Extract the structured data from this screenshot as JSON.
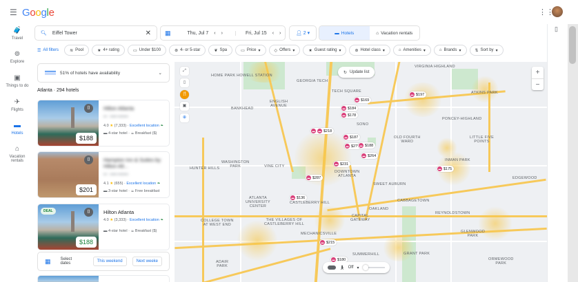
{
  "header": {
    "brand": "Google",
    "menu_icon": "menu-icon",
    "apps_icon": "apps-grid-icon"
  },
  "rail": [
    {
      "label": "Travel",
      "icon": "suitcase-icon"
    },
    {
      "label": "Explore",
      "icon": "explore-icon"
    },
    {
      "label": "Things to do",
      "icon": "camera-icon"
    },
    {
      "label": "Flights",
      "icon": "airplane-icon"
    },
    {
      "label": "Hotels",
      "icon": "bed-icon",
      "active": true
    },
    {
      "label": "Vacation rentals",
      "icon": "house-icon"
    }
  ],
  "search": {
    "value": "Eiffel Tower"
  },
  "dates": {
    "checkin": "Thu, Jul 7",
    "checkout": "Fri, Jul 15"
  },
  "guests": {
    "count": "2"
  },
  "tabs": {
    "hotels": "Hotels",
    "vacation": "Vacation rentals"
  },
  "filters": [
    "All filters",
    "Pool",
    "4+ rating",
    "Under $100",
    "4- or 5-star",
    "Spa",
    "Price",
    "Offers",
    "Guest rating",
    "Hotel class",
    "Amenities",
    "Brands",
    "Sort by"
  ],
  "availability": "51% of hotels have availability",
  "results_count": "Atlanta · 294 hotels",
  "hotels": [
    {
      "name": "Hilton Atlanta",
      "price": "$188",
      "rating": "4.0",
      "reviews": "(7,333)",
      "highlight": "Excellent location",
      "class": "4-star hotel",
      "amenity": "Breakfast ($)",
      "deal": false
    },
    {
      "name": "Hampton Inn & Suites by Hilton Atl...",
      "price": "$201",
      "rating": "4.1",
      "reviews": "(655)",
      "highlight": "Excellent location",
      "class": "3-star hotel",
      "amenity": "Free breakfast",
      "deal": false
    },
    {
      "name": "Hilton Atlanta",
      "price": "$188",
      "rating": "4.0",
      "reviews": "(3,333)",
      "highlight": "Excellent location",
      "class": "4-star hotel",
      "amenity": "Breakfast ($)",
      "deal": true,
      "deal_label": "DEAL"
    }
  ],
  "select_dates": {
    "label": "Select dates",
    "this_weekend": "This weekend",
    "next_weekend": "Next weeke"
  },
  "map": {
    "update_list": "Update list",
    "walk_label": "Off",
    "labels": [
      "HOME PARK\nHOWELL STATION",
      "GEORGIA TECH",
      "VIRGINIA HIGHLAND",
      "TECH SQUARE",
      "ENGLISH\nAVENUE",
      "BANKHEAD",
      "ATKINS PARK",
      "SONO",
      "PONCEY-HIGHLAND",
      "OLD FOURTH\nWARD",
      "LITTLE FIVE\nPOINTS",
      "INMAN PARK",
      "DOWNTOWN\nATLANTA",
      "WASHINGTON\nPARK",
      "VINE CITY",
      "HUNTER HILLS",
      "EDGEWOOD",
      "SWEET AUBURN",
      "ATLANTA\nUNIVERSITY\nCENTER",
      "CASTLEBERRY HILL",
      "OAKLAND",
      "CAPITAL\nGATEWAY",
      "REYNOLDSTOWN",
      "GLENWOOD\nPARK",
      "MECHANICSVILLE",
      "SUMMERHILL",
      "GRANT PARK",
      "ORMEWOOD\nPARK",
      "COLLEGE TOWN\nAT WEST END",
      "THE VILLAGES OF\nCASTLEBERRY HILL",
      "CABBAGETOWN",
      "ADAIR\nPARK"
    ],
    "pins": [
      "$197",
      "$169",
      "$184",
      "$178",
      "$218",
      "$187",
      "$2??",
      "$188",
      "$264",
      "$231",
      "$287",
      "$175",
      "$136",
      "$215",
      "$180"
    ]
  }
}
